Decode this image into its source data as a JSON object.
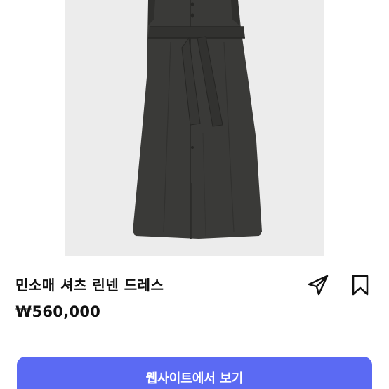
{
  "product": {
    "image_name": "dress-product-photo",
    "title": "민소매 셔츠 린넨 드레스",
    "price": "₩560,000"
  },
  "actions": {
    "share_icon": "send-icon",
    "bookmark_icon": "bookmark-icon"
  },
  "cta": {
    "label": "웹사이트에서 보기"
  },
  "colors": {
    "image_background": "#ececec",
    "dress": "#3a3a38",
    "cta_background": "#5b6af3",
    "text": "#111111"
  }
}
